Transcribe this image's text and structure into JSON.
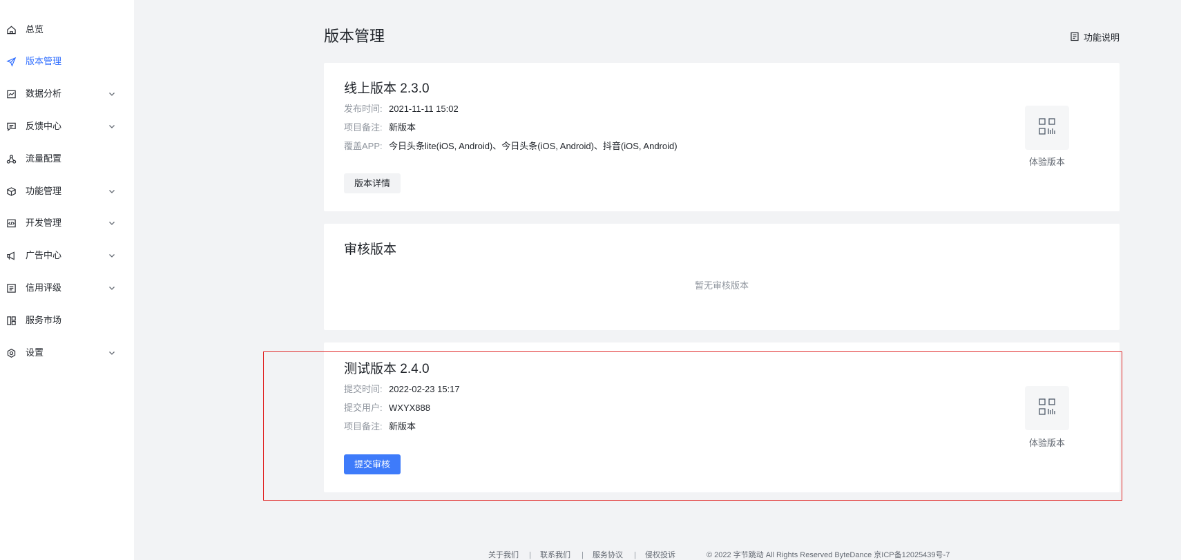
{
  "sidebar": {
    "items": [
      {
        "label": "总览",
        "icon": "home-icon",
        "expandable": false,
        "active": false
      },
      {
        "label": "版本管理",
        "icon": "send-icon",
        "expandable": false,
        "active": true
      },
      {
        "label": "数据分析",
        "icon": "chart-icon",
        "expandable": true,
        "active": false
      },
      {
        "label": "反馈中心",
        "icon": "message-icon",
        "expandable": true,
        "active": false
      },
      {
        "label": "流量配置",
        "icon": "nodes-icon",
        "expandable": false,
        "active": false
      },
      {
        "label": "功能管理",
        "icon": "cube-icon",
        "expandable": true,
        "active": false
      },
      {
        "label": "开发管理",
        "icon": "code-icon",
        "expandable": true,
        "active": false
      },
      {
        "label": "广告中心",
        "icon": "megaphone-icon",
        "expandable": true,
        "active": false
      },
      {
        "label": "信用评级",
        "icon": "list-icon",
        "expandable": true,
        "active": false
      },
      {
        "label": "服务市场",
        "icon": "layout-icon",
        "expandable": false,
        "active": false
      },
      {
        "label": "设置",
        "icon": "gear-icon",
        "expandable": true,
        "active": false
      }
    ]
  },
  "header": {
    "title": "版本管理",
    "help_label": "功能说明"
  },
  "online_version": {
    "title": "线上版本 2.3.0",
    "fields": [
      {
        "key": "发布时间:",
        "value": "2021-11-11 15:02"
      },
      {
        "key": "项目备注:",
        "value": "新版本"
      },
      {
        "key": "覆盖APP:",
        "value": "今日头条lite(iOS, Android)、今日头条(iOS, Android)、抖音(iOS, Android)"
      }
    ],
    "button_label": "版本详情",
    "qr_label": "体验版本"
  },
  "review_version": {
    "title": "审核版本",
    "empty_text": "暂无审核版本"
  },
  "test_version": {
    "title": "测试版本 2.4.0",
    "fields": [
      {
        "key": "提交时间:",
        "value": "2022-02-23 15:17"
      },
      {
        "key": "提交用户:",
        "value": "WXYX888"
      },
      {
        "key": "项目备注:",
        "value": "新版本"
      }
    ],
    "button_label": "提交审核",
    "qr_label": "体验版本"
  },
  "footer": {
    "links": [
      "关于我们",
      "联系我们",
      "服务协议",
      "侵权投诉"
    ],
    "separator": "|",
    "copyright": "© 2022 字节跳动 All Rights Reserved ByteDance 京ICP备12025439号-7"
  },
  "colors": {
    "accent": "#3370ff",
    "primary_button": "#3e7bfa",
    "highlight_border": "#e02424",
    "page_background": "#f2f3f5"
  }
}
